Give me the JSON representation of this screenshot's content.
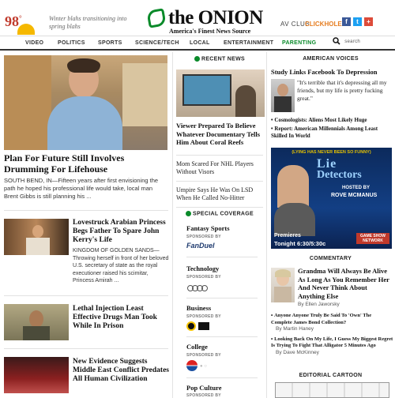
{
  "header": {
    "temperature": "98",
    "degree": "°",
    "weather_text": "Winter blahs transitioning into spring blahs",
    "logo": "the ONION",
    "tagline": "America's Finest News Source",
    "av_club": "AV CLUB",
    "clickhole": "CLICKHOLE",
    "social": [
      "f",
      "t",
      "+"
    ]
  },
  "nav": {
    "items": [
      "VIDEO",
      "POLITICS",
      "SPORTS",
      "SCIENCE/TECH",
      "LOCAL",
      "ENTERTAINMENT",
      "PARENTING"
    ],
    "search_label": "search"
  },
  "colors": {
    "accent": "#0a8a2a",
    "brand_red": "#c0392b",
    "clickhole": "#e67e22",
    "facebook": "#3b5998",
    "twitter": "#1da1f2",
    "google": "#dd4b39"
  },
  "main": {
    "lead_headline": "Plan For Future Still Involves Drumming For Lifehouse",
    "lead_body": "SOUTH BEND, IN—Fifteen years after first envisioning the path he hoped his professional life would take, local man Brent Gibbs is still planning his ...",
    "stories": [
      {
        "headline": "Lovestruck Arabian Princess Begs Father To Spare John Kerry's Life",
        "body": "KINGDOM OF GOLDEN SANDS—Throwing herself in front of her beloved U.S. secretary of state as the royal executioner raised his scimitar, Princess Amirah ..."
      },
      {
        "headline": "Lethal Injection Least Effective Drugs Man Took While In Prison",
        "body": ""
      },
      {
        "headline": "New Evidence Suggests Middle East Conflict Predates All Human Civilization",
        "body": ""
      }
    ]
  },
  "recent": {
    "header": "RECENT NEWS",
    "items": [
      "Viewer Prepared To Believe Whatever Documentary Tells Him About Coral Reefs",
      "Mom Scared For NHL Players Without Visors",
      "Umpire Says He Was On LSD When He Called No-Hitter"
    ]
  },
  "special": {
    "header": "SPECIAL COVERAGE",
    "sponsored_by": "SPONSORED BY",
    "sections": [
      {
        "title": "Fantasy Sports",
        "sponsor": "FanDuel"
      },
      {
        "title": "Technology",
        "sponsor": "Audi"
      },
      {
        "title": "Business",
        "sponsor": "Buffalo Wild Wings"
      },
      {
        "title": "College",
        "sponsor": "Pepsi"
      },
      {
        "title": "Pop Culture",
        "sponsor": ""
      }
    ]
  },
  "voices": {
    "header": "AMERICAN VOICES",
    "headline": "Study Links Facebook To Depression",
    "quote": "\"It's terrible that it's depressing all my friends, but my life is pretty fucking great.\"",
    "bullets": [
      "Cosmologists: Aliens Most Likely Huge",
      "Report: American Millennials Among Least Skilled In World"
    ]
  },
  "ad": {
    "top": "(LYING HAS NEVER BEEN SO FUNNY)",
    "title_line1": "Lie",
    "title_line2": "Detectors",
    "hosted": "HOSTED BY",
    "host": "ROVE MCMANUS",
    "premieres": "Premieres",
    "time": "Tonight 6:30/5:30c",
    "network": "GAME SHOW NETWORK"
  },
  "commentary": {
    "header": "COMMENTARY",
    "headline": "Grandma Will Always Be Alive As Long As You Remember Her And Never Think About Anything Else",
    "byline": "By Ellen Jaworsky",
    "items": [
      {
        "title": "Anyone Anyone Truly Be Said To 'Own' The Complete James Bond Collection?",
        "by": "By Martin Haney"
      },
      {
        "title": "Looking Back On My Life, I Guess My Biggest Regret Is Trying To Fight That Alligator 5 Minutes Ago",
        "by": "By Dave McKinney"
      }
    ],
    "cartoon_header": "EDITORIAL CARTOON"
  }
}
